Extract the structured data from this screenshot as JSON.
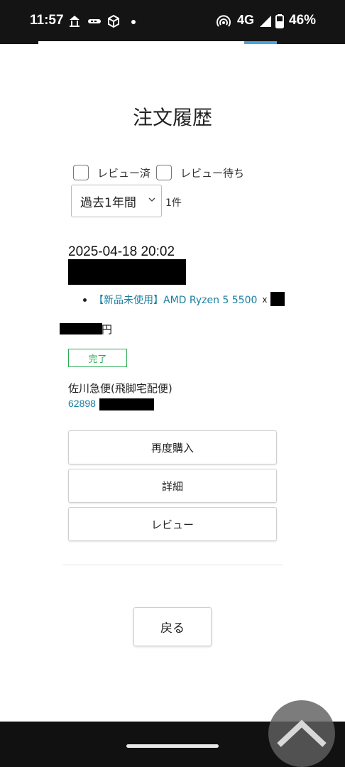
{
  "status_bar": {
    "time": "11:57",
    "network": "4G",
    "battery": "46%",
    "icons": [
      "temple-icon",
      "train-icon",
      "cube-icon",
      "dot-icon",
      "hotspot-icon",
      "signal-icon",
      "battery-icon"
    ]
  },
  "page": {
    "title": "注文履歴"
  },
  "filters": {
    "reviewed_label": "レビュー済",
    "pending_label": "レビュー待ち",
    "period_value": "過去1年間",
    "count": "1件"
  },
  "order": {
    "date": "2025-04-18 20:02",
    "item_name": "【新品未使用】AMD Ryzen 5 5500",
    "quantity_prefix": "x",
    "price_suffix": "円",
    "status": "完了",
    "carrier": "佐川急便(飛脚宅配便)",
    "tracking_prefix": "62898"
  },
  "actions": {
    "rebuy": "再度購入",
    "details": "詳細",
    "review": "レビュー"
  },
  "nav": {
    "back": "戻る"
  },
  "colors": {
    "link": "#1a7fa0",
    "status_green": "#2eaa55",
    "accent_blue": "#4aa3d8"
  }
}
